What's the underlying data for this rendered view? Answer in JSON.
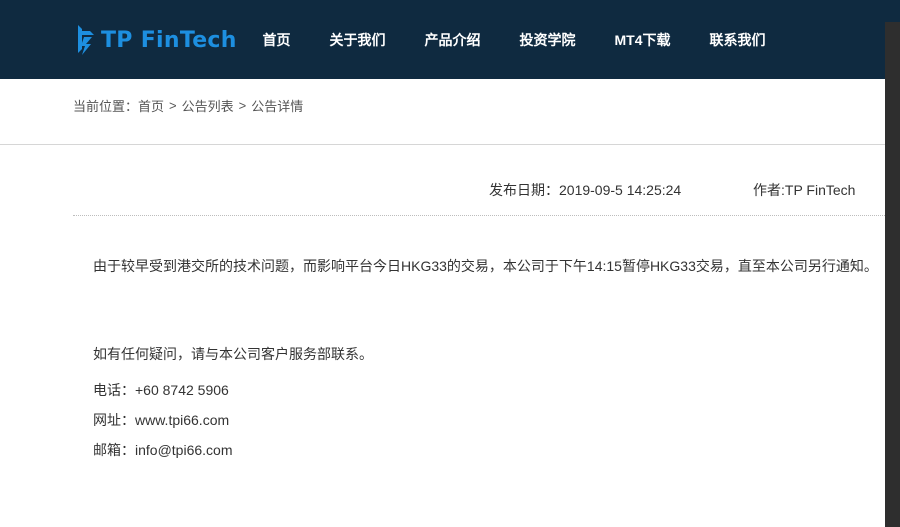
{
  "header": {
    "logo_text": "TP FinTech",
    "logo_color": "#1d8fe0",
    "background_color": "#0f2a40",
    "nav": [
      {
        "label": "首页"
      },
      {
        "label": "关于我们"
      },
      {
        "label": "产品介绍"
      },
      {
        "label": "投资学院"
      },
      {
        "label": "MT4下载"
      },
      {
        "label": "联系我们"
      }
    ]
  },
  "breadcrumb": {
    "prefix": "当前位置：",
    "items": [
      "首页",
      "公告列表",
      "公告详情"
    ],
    "separator": ">"
  },
  "article": {
    "date_label": "发布日期：",
    "date": "2019-09-5 14:25:24",
    "author_label": "作者:",
    "author": "TP FinTech",
    "paragraphs": {
      "notice": "由于较早受到港交所的技术问题，而影响平台今日HKG33的交易，本公司于下午14:15暂停HKG33交易，直至本公司另行通知。",
      "question": "如有任何疑问，请与本公司客户服务部联系。",
      "phone": "电话：+60 8742 5906",
      "website": "网址：www.tpi66.com",
      "email": "邮箱：info@tpi66.com"
    }
  }
}
